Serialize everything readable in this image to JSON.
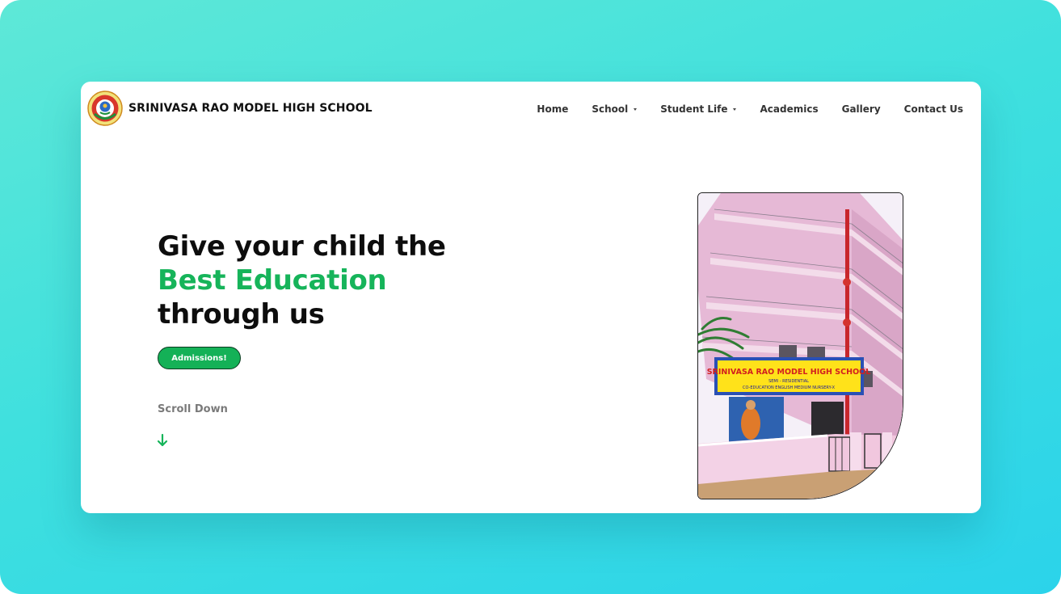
{
  "header": {
    "brand": "SRINIVASA RAO MODEL HIGH SCHOOL",
    "nav": [
      {
        "label": "Home",
        "dropdown": false
      },
      {
        "label": "School",
        "dropdown": true
      },
      {
        "label": "Student Life",
        "dropdown": true
      },
      {
        "label": "Academics",
        "dropdown": false
      },
      {
        "label": "Gallery",
        "dropdown": false
      },
      {
        "label": "Contact Us",
        "dropdown": false
      }
    ]
  },
  "hero": {
    "line1": "Give your child the",
    "line2": "Best Education",
    "line3": "through us",
    "cta_label": "Admissions!",
    "scroll_label": "Scroll Down"
  },
  "photo": {
    "sign_title": "SRINIVASA RAO MODEL HIGH SCHOOL",
    "sign_line1": "SEMI - RESIDENTIAL",
    "sign_line2": "CO-EDUCATION   ENGLISH MEDIUM   NURSERY-X"
  },
  "colors": {
    "accent": "#16b45a",
    "background_gradient_start": "#5ee8d7",
    "background_gradient_end": "#2bd3ea"
  },
  "icons": {
    "logo": "school-emblem-icon",
    "scroll": "arrow-down-icon",
    "dropdown": "caret-down-icon"
  }
}
